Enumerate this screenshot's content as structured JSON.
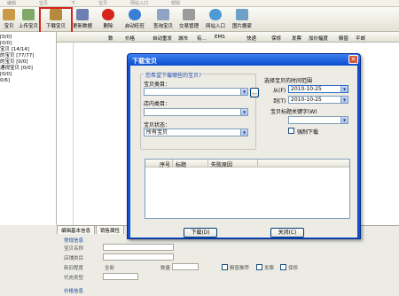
{
  "menubar": [
    "编辑",
    "宝贝",
    "下",
    "宝贝",
    "网站入口",
    "帮助"
  ],
  "toolbar": {
    "buttons": [
      {
        "label": "宝贝",
        "icon": "box-icon"
      },
      {
        "label": "上传宝贝",
        "icon": "upload-icon"
      },
      {
        "label": "下载宝贝",
        "icon": "download-icon"
      },
      {
        "label": "更新数据",
        "icon": "chart-icon"
      },
      {
        "label": "删除",
        "icon": "delete-icon"
      },
      {
        "label": "启动旺旺",
        "icon": "wangwang-icon"
      },
      {
        "label": "查询宝贝",
        "icon": "search-icon"
      },
      {
        "label": "交易管理",
        "icon": "gear-icon"
      },
      {
        "label": "网站入口",
        "icon": "globe-icon"
      },
      {
        "label": "图片搬家",
        "icon": "image-icon"
      }
    ]
  },
  "sidebar": [
    "[0/0]",
    "[0/0]",
    "宝贝 [14/14]",
    "的宝贝 [77/77]",
    "的宝贝 [0/0]",
    "通视宝贝 [0/0]",
    "[0/0]",
    "0/6]"
  ],
  "grid": {
    "columns": [
      "数",
      "价格",
      "自动重发",
      "城市",
      "有...",
      "EMS",
      "快递",
      "保修",
      "发票",
      "加价幅度",
      "橱窗",
      "平邮"
    ]
  },
  "bottom": {
    "tabs": [
      "编辑基本信息",
      "销售属性"
    ],
    "section1": "常规信息",
    "labels": [
      "宝贝名称",
      "店铺类目",
      "新旧程度",
      "代充类型"
    ],
    "condition_value": "全新",
    "quantity_label": "数量",
    "checkbox_labels": [
      "橱窗推荐",
      "发票",
      "保修"
    ],
    "section2": "价格信息"
  },
  "dialog": {
    "title": "下载宝贝",
    "close": "✕",
    "left_group_legend": "您希望下载哪些的宝贝?",
    "category_label": "宝贝类目：",
    "category_value": "",
    "browse_btn": "...",
    "shop_category_label": "店内类目：",
    "shop_category_value": "",
    "status_label": "宝贝状态：",
    "status_value": "所有宝贝",
    "right_group_legend": "选择宝贝的时间范围",
    "from_label": "从(F)",
    "from_date": "2010-10-25",
    "to_label": "到(T)",
    "to_date": "2010-10-25",
    "keyword_label": "宝贝标题关键字(W)",
    "keyword_value": "",
    "force_label": "强制下载",
    "table_headers": [
      "序号",
      "标题",
      "失败原因"
    ],
    "download_btn": "下载(D)",
    "close_btn": "关闭(C)"
  },
  "colors": {
    "highlight": "#d8231c",
    "title_bar": "#0a4ed0",
    "legend_text": "#1d4aa8"
  }
}
